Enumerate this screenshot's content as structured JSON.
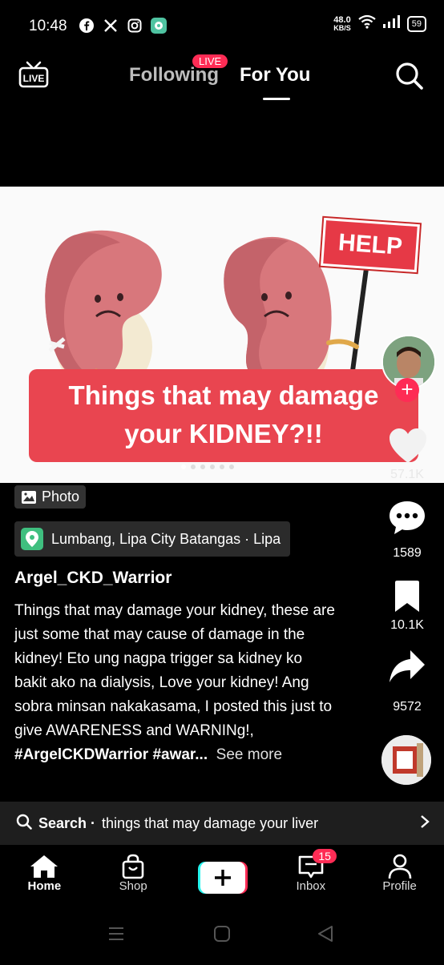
{
  "status_bar": {
    "time": "10:48",
    "app_icons": [
      "facebook-icon",
      "x-icon",
      "instagram-icon",
      "chat-app-icon"
    ],
    "net_speed_value": "48.0",
    "net_speed_unit": "KB/S",
    "battery": "59"
  },
  "top_nav": {
    "live_icon_label": "LIVE",
    "following_label": "Following",
    "live_badge": "LIVE",
    "for_you_label": "For You"
  },
  "post": {
    "help_sign": "HELP",
    "banner_line1": "Things that may damage",
    "banner_line2": "your KIDNEY?!!",
    "photo_chip": "Photo",
    "location": "Lumbang, Lipa City Batangas · Lipa",
    "username": "Argel_CKD_Warrior",
    "caption": "Things that may damage your kidney, these are just some that may cause of damage in the kidney! Eto ung nagpa trigger sa kidney ko bakit ako na dialysis, Love your kidney! Ang sobra minsan nakakasama, I posted this just to give AWARENESS and WARNINg!,",
    "hashtags": "#ArgelCKDWarrior #awar...",
    "see_more": "See more",
    "image_count": 6
  },
  "actions": {
    "likes": "57.1K",
    "comments": "1589",
    "saves": "10.1K",
    "shares": "9572"
  },
  "search_suggestion": {
    "prefix": "Search ·",
    "query": "things that may damage your liver"
  },
  "bottom_nav": {
    "home": "Home",
    "shop": "Shop",
    "inbox": "Inbox",
    "inbox_badge": "15",
    "profile": "Profile"
  },
  "colors": {
    "accent": "#fe2c55",
    "banner": "#e94550",
    "location_pin": "#3fbf7f"
  }
}
